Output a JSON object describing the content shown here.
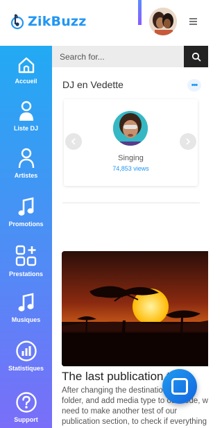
{
  "app": {
    "name": "ZikBuzz"
  },
  "colors": {
    "brand": "#2196f3",
    "sidebar_top": "#22aaf3",
    "sidebar_bottom": "#7a6ef9",
    "search_button": "#232323"
  },
  "sidebar": {
    "items": [
      {
        "label": "Accueil",
        "icon": "home-icon"
      },
      {
        "label": "Liste DJ",
        "icon": "user-icon"
      },
      {
        "label": "Artistes",
        "icon": "user-outline-icon"
      },
      {
        "label": "Promotions",
        "icon": "music-note-icon"
      },
      {
        "label": "Prestations",
        "icon": "grid-plus-icon"
      },
      {
        "label": "Musiques",
        "icon": "music-note-icon"
      },
      {
        "label": "Statistiques",
        "icon": "bar-chart-icon"
      },
      {
        "label": "Support",
        "icon": "question-icon"
      }
    ]
  },
  "search": {
    "placeholder": "Search for...",
    "value": ""
  },
  "dj_section": {
    "title": "DJ en Vedette",
    "more": "•••",
    "featured": {
      "name": "Singing",
      "views": "74,853 views"
    }
  },
  "publication": {
    "title": "The last publication test",
    "body_lines": [
      "After changing the destination",
      "folder, and add media type to our code, we",
      "need to make another test of our",
      "publication section, to check if everything"
    ]
  }
}
